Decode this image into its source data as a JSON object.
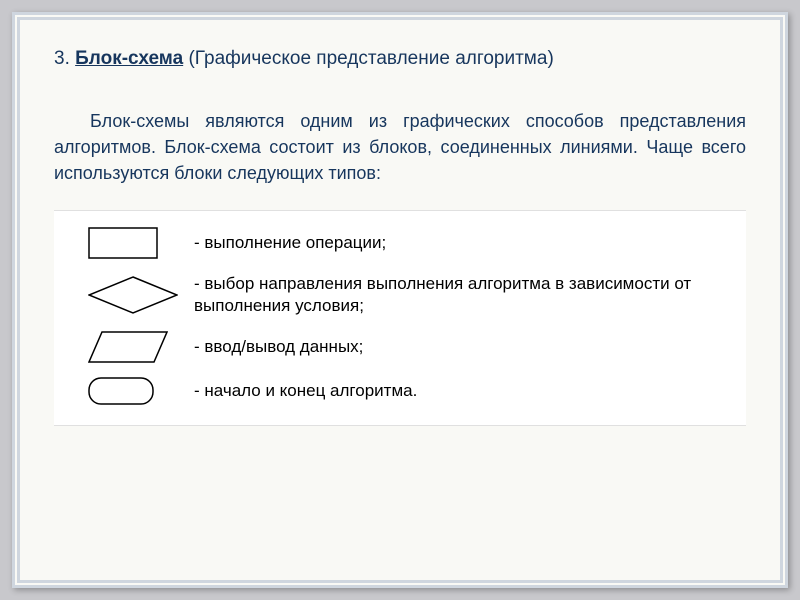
{
  "heading": {
    "number": "3.",
    "term": "Блок-схема",
    "paren": "(Графическое представление алгоритма)"
  },
  "body_text": "Блок-схемы являются одним из графических способов представления алгоритмов. Блок-схема состоит из блоков, соединенных линиями. Чаще всего используются блоки следующих типов:",
  "items": [
    {
      "shape": "rect",
      "desc": "- выполнение операции;"
    },
    {
      "shape": "diamond",
      "desc": "- выбор направления выполнения алгоритма в зависимости от выполнения условия;"
    },
    {
      "shape": "parallelogram",
      "desc": "- ввод/вывод данных;"
    },
    {
      "shape": "round-rect",
      "desc": "- начало и конец алгоритма."
    }
  ]
}
